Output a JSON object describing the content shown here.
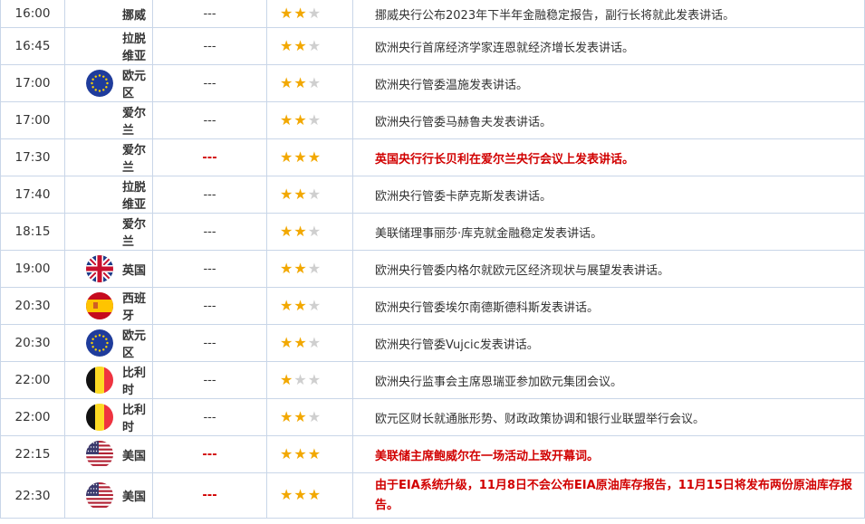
{
  "rows": [
    {
      "time": "16:00",
      "flag": "none",
      "country": "挪威",
      "prev": "---",
      "stars": 2,
      "important": false,
      "desc": "挪威央行公布2023年下半年金融稳定报告，副行长将就此发表讲话。"
    },
    {
      "time": "16:45",
      "flag": "none",
      "country": "拉脱维亚",
      "prev": "---",
      "stars": 2,
      "important": false,
      "desc": "欧洲央行首席经济学家连恩就经济增长发表讲话。"
    },
    {
      "time": "17:00",
      "flag": "eu",
      "country": "欧元区",
      "prev": "---",
      "stars": 2,
      "important": false,
      "desc": "欧洲央行管委温施发表讲话。"
    },
    {
      "time": "17:00",
      "flag": "none",
      "country": "爱尔兰",
      "prev": "---",
      "stars": 2,
      "important": false,
      "desc": "欧洲央行管委马赫鲁夫发表讲话。"
    },
    {
      "time": "17:30",
      "flag": "none",
      "country": "爱尔兰",
      "prev": "---",
      "stars": 3,
      "important": true,
      "desc": "英国央行行长贝利在爱尔兰央行会议上发表讲话。"
    },
    {
      "time": "17:40",
      "flag": "none",
      "country": "拉脱维亚",
      "prev": "---",
      "stars": 2,
      "important": false,
      "desc": "欧洲央行管委卡萨克斯发表讲话。"
    },
    {
      "time": "18:15",
      "flag": "none",
      "country": "爱尔兰",
      "prev": "---",
      "stars": 2,
      "important": false,
      "desc": "美联储理事丽莎·库克就金融稳定发表讲话。"
    },
    {
      "time": "19:00",
      "flag": "uk",
      "country": "英国",
      "prev": "---",
      "stars": 2,
      "important": false,
      "desc": "欧洲央行管委内格尔就欧元区经济现状与展望发表讲话。"
    },
    {
      "time": "20:30",
      "flag": "es",
      "country": "西班牙",
      "prev": "---",
      "stars": 2,
      "important": false,
      "desc": "欧洲央行管委埃尔南德斯德科斯发表讲话。"
    },
    {
      "time": "20:30",
      "flag": "eu",
      "country": "欧元区",
      "prev": "---",
      "stars": 2,
      "important": false,
      "desc": "欧洲央行管委Vujcic发表讲话。"
    },
    {
      "time": "22:00",
      "flag": "be",
      "country": "比利时",
      "prev": "---",
      "stars": 1,
      "important": false,
      "desc": "欧洲央行监事会主席恩瑞亚参加欧元集团会议。"
    },
    {
      "time": "22:00",
      "flag": "be",
      "country": "比利时",
      "prev": "---",
      "stars": 2,
      "important": false,
      "desc": "欧元区财长就通胀形势、财政政策协调和银行业联盟举行会议。"
    },
    {
      "time": "22:15",
      "flag": "us",
      "country": "美国",
      "prev": "---",
      "stars": 3,
      "important": true,
      "desc": "美联储主席鲍威尔在一场活动上致开幕词。"
    },
    {
      "time": "22:30",
      "flag": "us",
      "country": "美国",
      "prev": "---",
      "stars": 3,
      "important": true,
      "desc": "由于EIA系统升级，11月8日不会公布EIA原油库存报告，11月15日将发布两份原油库存报告。"
    }
  ],
  "colors": {
    "accent_red": "#d10000",
    "star_on": "#f2a800",
    "star_off": "#cfcfcf",
    "border": "#c9d6e8"
  }
}
